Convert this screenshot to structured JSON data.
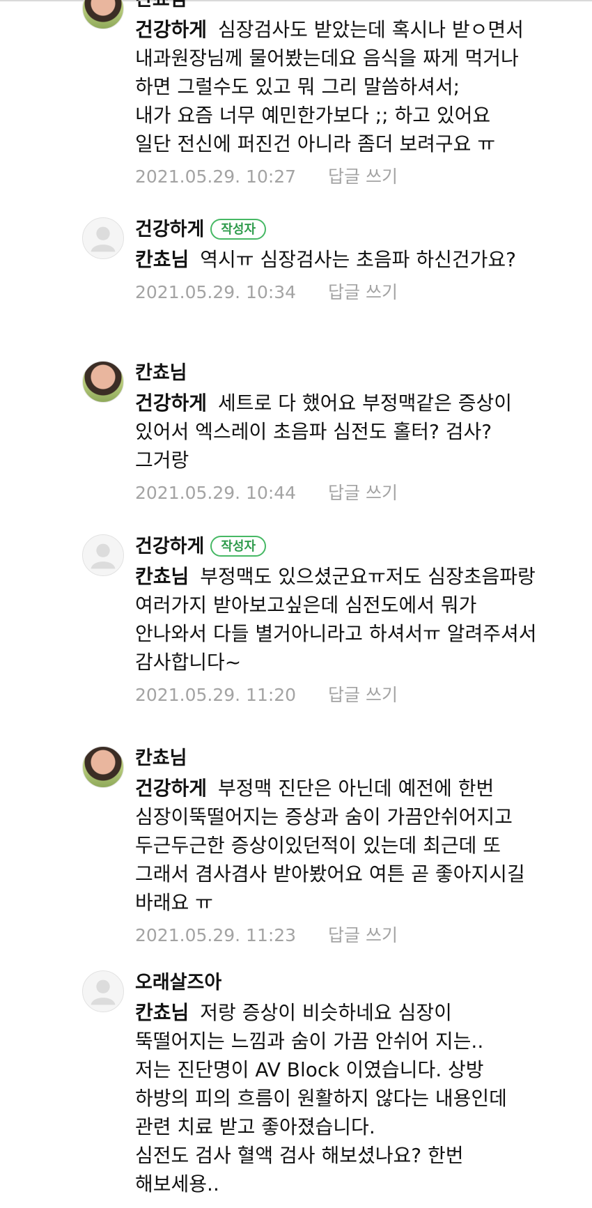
{
  "comments": [
    {
      "author": "칸쵸님",
      "badge": "",
      "mention": "건강하게",
      "text": "심장검사도 받았는데 혹시나 받ㅇ면서 내과원장님께 물어봤는데요 음식을 짜게 먹거나 하면 그럴수도 있고 뭐 그리 말씀하셔서;\n내가 요즘 너무 예민한가보다 ;; 하고 있어요\n일단 전신에 퍼진건 아니라 좀더 보려구요 ㅠ",
      "date": "2021.05.29. 10:27",
      "reply": "답글 쓰기",
      "avatar": "profile-photo"
    },
    {
      "author": "건강하게",
      "badge": "작성자",
      "mention": "칸쵸님",
      "text": "역시ㅠ 심장검사는 초음파 하신건가요?",
      "date": "2021.05.29. 10:34",
      "reply": "답글 쓰기",
      "avatar": "default-profile"
    },
    {
      "author": "칸쵸님",
      "badge": "",
      "mention": "건강하게",
      "text": "세트로 다 했어요 부정맥같은 증상이 있어서 엑스레이 초음파 심전도 홀터? 검사? 그거랑",
      "date": "2021.05.29. 10:44",
      "reply": "답글 쓰기",
      "avatar": "profile-photo"
    },
    {
      "author": "건강하게",
      "badge": "작성자",
      "mention": "칸쵸님",
      "text": "부정맥도 있으셨군요ㅠ저도 심장초음파랑 여러가지 받아보고싶은데 심전도에서 뭐가 안나와서 다들 별거아니라고 하셔서ㅠ 알려주셔서 감사합니다~",
      "date": "2021.05.29. 11:20",
      "reply": "답글 쓰기",
      "avatar": "default-profile"
    },
    {
      "author": "칸쵸님",
      "badge": "",
      "mention": "건강하게",
      "text": "부정맥 진단은 아닌데 예전에 한번 심장이뚝떨어지는 증상과 숨이 가끔안쉬어지고 두근두근한 증상이있던적이 있는데 최근데 또 그래서 겸사겸사 받아봤어요 여튼 곧 좋아지시길 바래요 ㅠ",
      "date": "2021.05.29. 11:23",
      "reply": "답글 쓰기",
      "avatar": "profile-photo"
    },
    {
      "author": "오래살즈아",
      "badge": "",
      "mention": "칸쵸님",
      "text": "저랑 증상이 비슷하네요 심장이 뚝떨어지는 느낌과 숨이 가끔 안쉬어 지는..\n저는 진단명이 AV Block 이였습니다. 상방 하방의 피의 흐름이 원활하지 않다는 내용인데\n관련 치료 받고 좋아졌습니다.\n심전도 검사 혈액 검사 해보셨나요? 한번 해보세용..",
      "date": "",
      "reply": "",
      "avatar": "default-profile"
    }
  ]
}
